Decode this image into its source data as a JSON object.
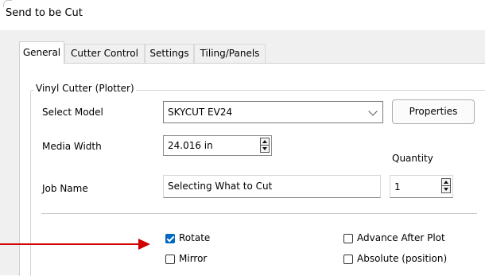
{
  "window": {
    "title": "Send to be Cut"
  },
  "tabs": [
    {
      "label": "General",
      "active": true
    },
    {
      "label": "Cutter Control",
      "active": false
    },
    {
      "label": "Settings",
      "active": false
    },
    {
      "label": "Tiling/Panels",
      "active": false
    }
  ],
  "group": {
    "label": "Vinyl Cutter (Plotter)",
    "select_model_label": "Select Model",
    "model_value": "SKYCUT EV24",
    "properties_label": "Properties",
    "media_width_label": "Media Width",
    "media_width_value": "24.016 in",
    "quantity_label": "Quantity",
    "quantity_value": "1",
    "job_name_label": "Job Name",
    "job_name_value": "Selecting What to  Cut"
  },
  "options": {
    "rotate": {
      "label": "Rotate",
      "checked": true
    },
    "mirror": {
      "label": "Mirror",
      "checked": false
    },
    "advance_after_plot": {
      "label": "Advance After Plot",
      "checked": false
    },
    "absolute_position": {
      "label": "Absolute (position)",
      "checked": false
    }
  },
  "annotation": {
    "arrow_color": "#d10000",
    "points_to": "rotate-checkbox"
  },
  "colors": {
    "accent": "#0067c0",
    "dialog_bg": "#f0f0f0"
  }
}
